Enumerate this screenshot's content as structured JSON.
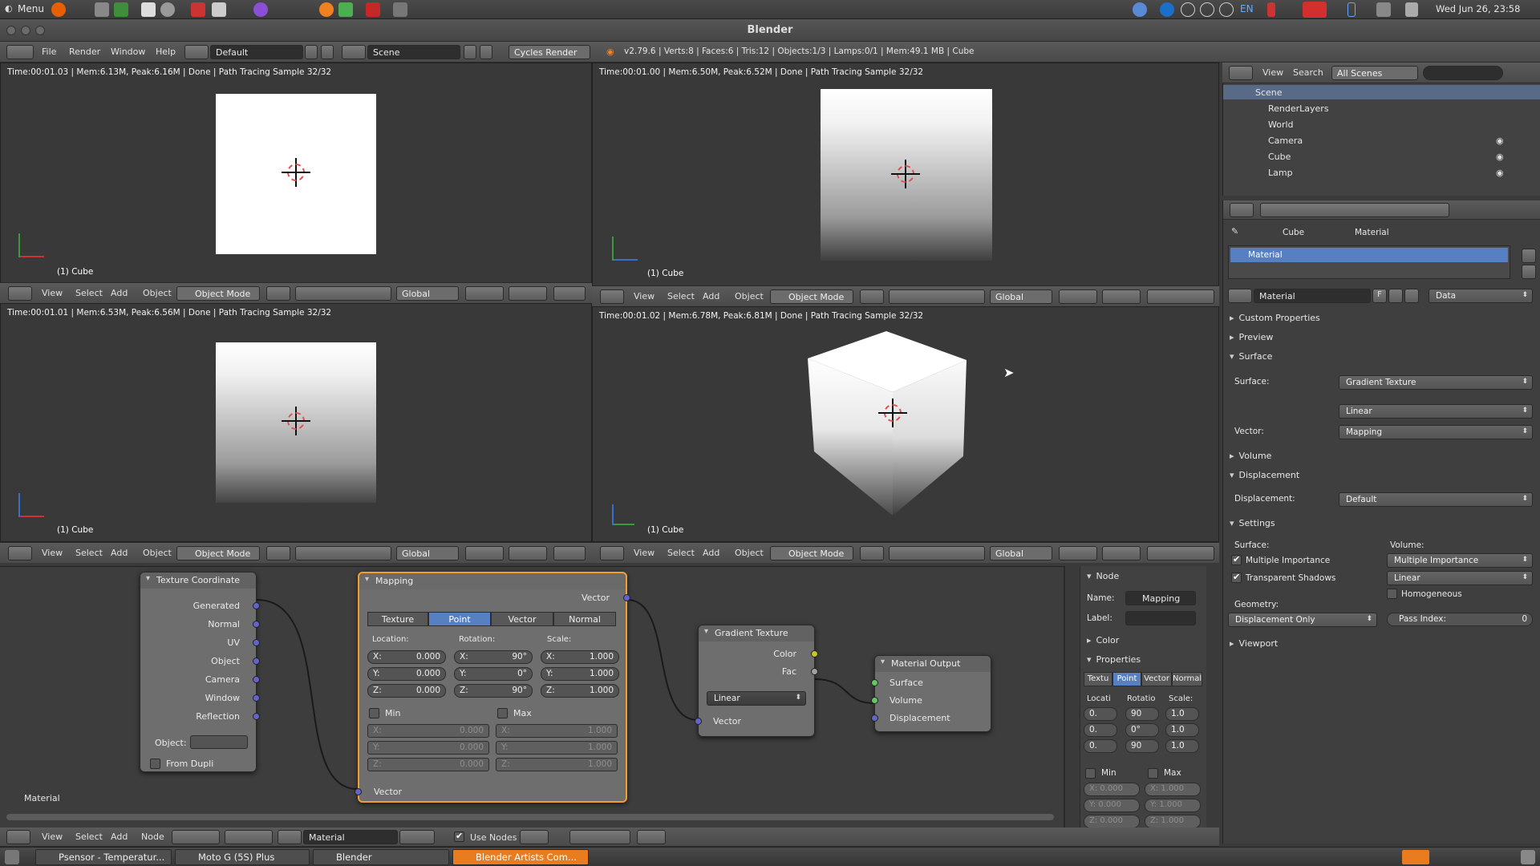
{
  "system_bar": {
    "menu_label": "Menu",
    "lang": "EN",
    "clock": "Wed Jun 26, 23:58"
  },
  "window": {
    "title": "Blender"
  },
  "info_header": {
    "menus": [
      "File",
      "Render",
      "Window",
      "Help"
    ],
    "layout": "Default",
    "scene": "Scene",
    "engine": "Cycles Render",
    "stats": "v2.79.6 | Verts:8 | Faces:6 | Tris:12 | Objects:1/3 | Lamps:0/1 | Mem:49.1 MB | Cube"
  },
  "viewports": [
    {
      "status": "Time:00:01.03 | Mem:6.13M, Peak:6.16M | Done | Path Tracing Sample 32/32",
      "label": "(1) Cube"
    },
    {
      "status": "Time:00:01.00 | Mem:6.50M, Peak:6.52M | Done | Path Tracing Sample 32/32",
      "label": "(1) Cube"
    },
    {
      "status": "Time:00:01.01 | Mem:6.53M, Peak:6.56M | Done | Path Tracing Sample 32/32",
      "label": "(1) Cube"
    },
    {
      "status": "Time:00:01.02 | Mem:6.78M, Peak:6.81M | Done | Path Tracing Sample 32/32",
      "label": "(1) Cube"
    }
  ],
  "viewport_bar": {
    "menus": [
      "View",
      "Select",
      "Add",
      "Object"
    ],
    "mode": "Object Mode",
    "orientation": "Global"
  },
  "nodes": {
    "texcoord": {
      "title": "Texture Coordinate",
      "outputs": [
        "Generated",
        "Normal",
        "UV",
        "Object",
        "Camera",
        "Window",
        "Reflection"
      ],
      "object_label": "Object:",
      "from_dupli": "From Dupli"
    },
    "mapping": {
      "title": "Mapping",
      "out": "Vector",
      "tabs": [
        "Texture",
        "Point",
        "Vector",
        "Normal"
      ],
      "loc_label": "Location:",
      "rot_label": "Rotation:",
      "scale_label": "Scale:",
      "loc": [
        "X:",
        "0.000",
        "Y:",
        "0.000",
        "Z:",
        "0.000"
      ],
      "rot": [
        "X:",
        "90°",
        "Y:",
        "0°",
        "Z:",
        "90°"
      ],
      "scale": [
        "X:",
        "1.000",
        "Y:",
        "1.000",
        "Z:",
        "1.000"
      ],
      "min_label": "Min",
      "max_label": "Max",
      "min": [
        "X:",
        "0.000",
        "Y:",
        "0.000",
        "Z:",
        "0.000"
      ],
      "max": [
        "X:",
        "1.000",
        "Y:",
        "1.000",
        "Z:",
        "1.000"
      ],
      "in": "Vector"
    },
    "gradient": {
      "title": "Gradient Texture",
      "out_color": "Color",
      "out_fac": "Fac",
      "type": "Linear",
      "in": "Vector"
    },
    "output": {
      "title": "Material Output",
      "inputs": [
        "Surface",
        "Volume",
        "Displacement"
      ]
    },
    "tree_label": "Material"
  },
  "node_sidebar": {
    "section": "Node",
    "name_label": "Name:",
    "name": "Mapping",
    "label_label": "Label:",
    "color": "Color",
    "properties": "Properties",
    "tabs": [
      "Textu",
      "Point",
      "Vector",
      "Normal"
    ],
    "cols": [
      "Locati",
      "Rotatio",
      "Scale:"
    ],
    "rows": [
      [
        "0.",
        "90",
        "1.0"
      ],
      [
        "0.",
        "0°",
        "1.0"
      ],
      [
        "0.",
        "90",
        "1.0"
      ]
    ],
    "min": "Min",
    "max": "Max",
    "minmax": [
      [
        "X: 0.000",
        "X: 1.000"
      ],
      [
        "Y: 0.000",
        "Y: 1.000"
      ],
      [
        "Z: 0.000",
        "Z: 1.000"
      ]
    ]
  },
  "node_header": {
    "menus": [
      "View",
      "Select",
      "Add",
      "Node"
    ],
    "material": "Material",
    "use_nodes": "Use Nodes"
  },
  "outliner": {
    "menus": [
      "View",
      "Search"
    ],
    "filter": "All Scenes",
    "items": [
      "Scene",
      "RenderLayers",
      "World",
      "Camera",
      "Cube",
      "Lamp"
    ]
  },
  "properties": {
    "breadcrumb": [
      "Cube",
      "Material"
    ],
    "slot": "Material",
    "material_name": "Material",
    "link": "Data",
    "f_label": "F",
    "panels": {
      "custom": "Custom Properties",
      "preview": "Preview",
      "surface": "Surface",
      "volume": "Volume",
      "displacement": "Displacement",
      "settings": "Settings",
      "viewport": "Viewport"
    },
    "surface_label": "Surface:",
    "surface_value": "Gradient Texture",
    "gradient_type": "Linear",
    "vector_label": "Vector:",
    "vector_value": "Mapping",
    "disp_label": "Displacement:",
    "disp_value": "Default",
    "set_surface": "Surface:",
    "set_volume": "Volume:",
    "multiple_importance": "Multiple Importance",
    "transparent_shadows": "Transparent Shadows",
    "vol_sampling": "Multiple Importance",
    "vol_interp": "Linear",
    "homogeneous": "Homogeneous",
    "geometry_label": "Geometry:",
    "geometry": "Displacement Only",
    "pass_index_label": "Pass Index:",
    "pass_index": "0"
  },
  "taskbar": {
    "items": [
      "Psensor - Temperatur...",
      "Moto G (5S) Plus",
      "Blender",
      "Blender Artists Com..."
    ]
  }
}
